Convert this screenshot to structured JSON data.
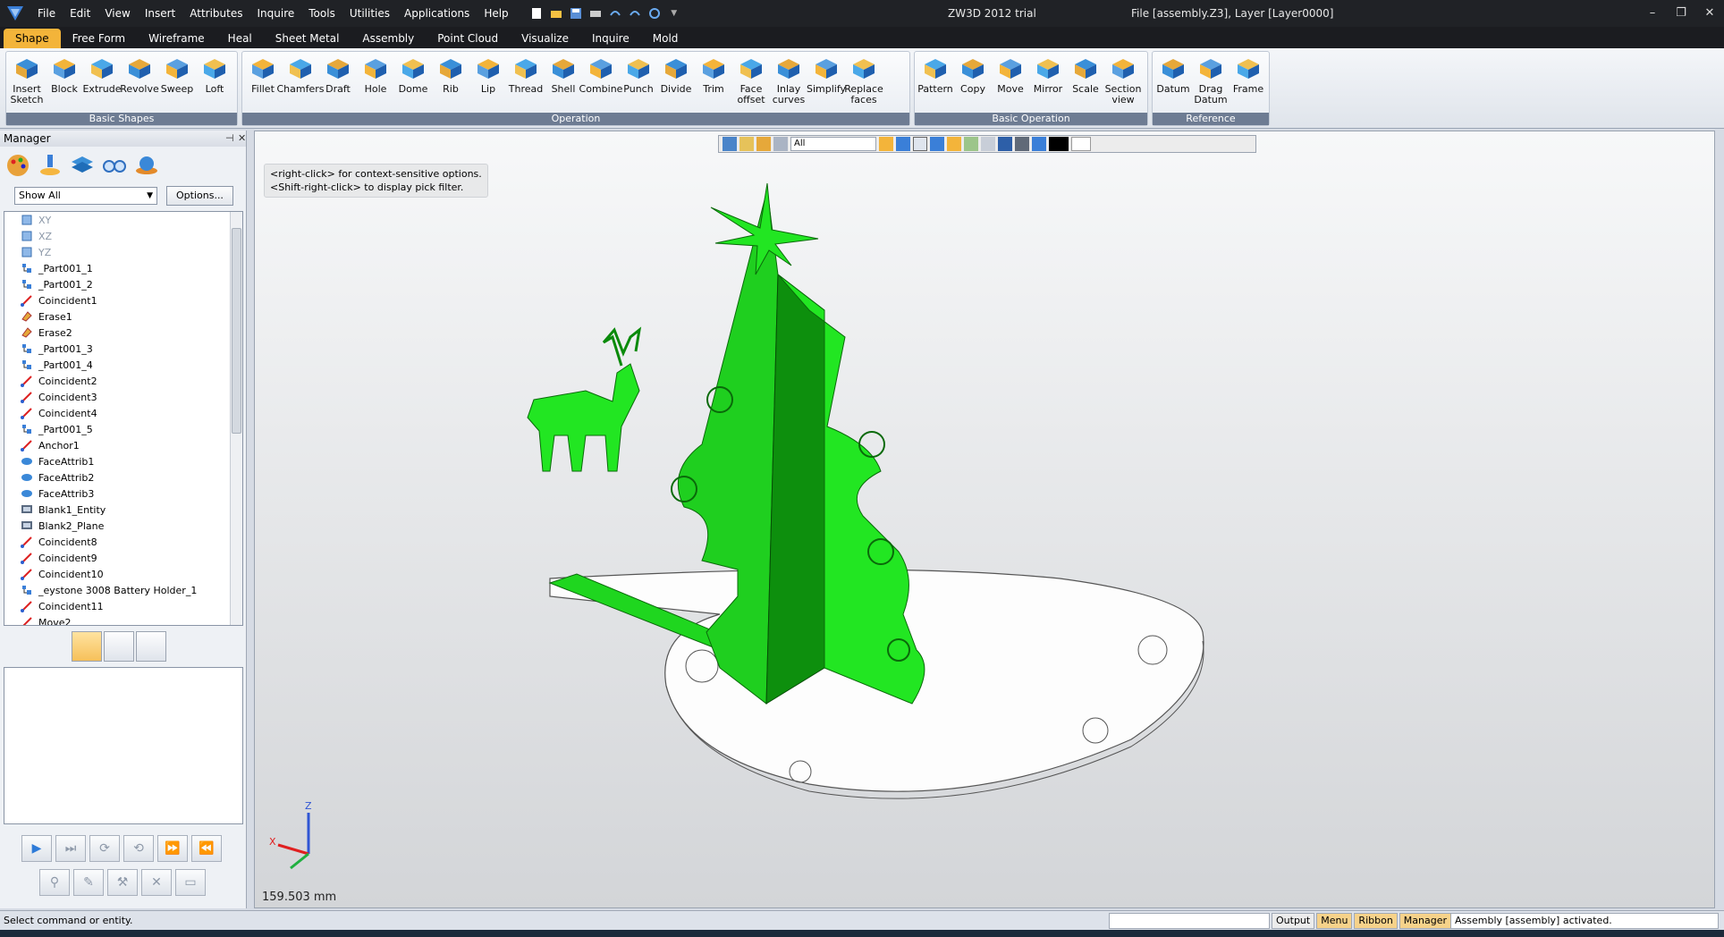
{
  "menu": [
    "File",
    "Edit",
    "View",
    "Insert",
    "Attributes",
    "Inquire",
    "Tools",
    "Utilities",
    "Applications",
    "Help"
  ],
  "window": {
    "app_title": "ZW3D 2012 trial",
    "file_info": "File [assembly.Z3],  Layer [Layer0000]"
  },
  "ribbon_tabs": [
    "Shape",
    "Free Form",
    "Wireframe",
    "Heal",
    "Sheet Metal",
    "Assembly",
    "Point Cloud",
    "Visualize",
    "Inquire",
    "Mold"
  ],
  "ribbon": {
    "groups": [
      {
        "label": "Basic Shapes",
        "tools": [
          "Insert Sketch",
          "Block",
          "Extrude",
          "Revolve",
          "Sweep",
          "Loft"
        ]
      },
      {
        "label": "Operation",
        "tools": [
          "Fillet",
          "Chamfers",
          "Draft",
          "Hole",
          "Dome",
          "Rib",
          "Lip",
          "Thread",
          "Shell",
          "Combine",
          "Punch",
          "Divide",
          "Trim",
          "Face offset",
          "Inlay curves",
          "Simplify",
          "Replace faces"
        ]
      },
      {
        "label": "Basic Operation",
        "tools": [
          "Pattern",
          "Copy",
          "Move",
          "Mirror",
          "Scale",
          "Section view"
        ]
      },
      {
        "label": "Reference",
        "tools": [
          "Datum",
          "Drag Datum",
          "Frame"
        ]
      }
    ]
  },
  "manager": {
    "title": "Manager",
    "filter_value": "Show All",
    "options_label": "Options...",
    "tree": [
      {
        "label": "XY",
        "icon": "plane-icon"
      },
      {
        "label": "XZ",
        "icon": "plane-icon"
      },
      {
        "label": "YZ",
        "icon": "plane-icon"
      },
      {
        "label": "_Part001_1",
        "icon": "part-icon"
      },
      {
        "label": "_Part001_2",
        "icon": "part-icon"
      },
      {
        "label": "Coincident1",
        "icon": "constraint-icon"
      },
      {
        "label": "Erase1",
        "icon": "erase-icon"
      },
      {
        "label": "Erase2",
        "icon": "erase-icon"
      },
      {
        "label": "_Part001_3",
        "icon": "part-icon"
      },
      {
        "label": "_Part001_4",
        "icon": "part-icon"
      },
      {
        "label": "Coincident2",
        "icon": "constraint-icon"
      },
      {
        "label": "Coincident3",
        "icon": "constraint-icon"
      },
      {
        "label": "Coincident4",
        "icon": "constraint-icon"
      },
      {
        "label": "_Part001_5",
        "icon": "part-icon"
      },
      {
        "label": "Anchor1",
        "icon": "constraint-icon"
      },
      {
        "label": "FaceAttrib1",
        "icon": "face-attrib-icon"
      },
      {
        "label": "FaceAttrib2",
        "icon": "face-attrib-icon"
      },
      {
        "label": "FaceAttrib3",
        "icon": "face-attrib-icon"
      },
      {
        "label": "Blank1_Entity",
        "icon": "blank-icon"
      },
      {
        "label": "Blank2_Plane",
        "icon": "blank-icon"
      },
      {
        "label": "Coincident8",
        "icon": "constraint-icon"
      },
      {
        "label": "Coincident9",
        "icon": "constraint-icon"
      },
      {
        "label": "Coincident10",
        "icon": "constraint-icon"
      },
      {
        "label": "_eystone 3008 Battery Holder_1",
        "icon": "part-icon"
      },
      {
        "label": "Coincident11",
        "icon": "constraint-icon"
      },
      {
        "label": "Move2",
        "icon": "constraint-icon"
      }
    ]
  },
  "viewport": {
    "hint_line1": "<right-click> for context-sensitive options.",
    "hint_line2": "<Shift-right-click> to display pick filter.",
    "pick_filter": "All",
    "scale_readout": "159.503 mm",
    "axis_z": "Z",
    "axis_x": "X"
  },
  "status": {
    "message": "Select command or entity.",
    "tabs": [
      "Output",
      "Menu",
      "Ribbon",
      "Manager"
    ],
    "info": "Assembly [assembly] activated."
  },
  "colors": {
    "model_green": "#22e622",
    "model_dark_green": "#0d8f0d",
    "accent_tab": "#f3b43a"
  }
}
